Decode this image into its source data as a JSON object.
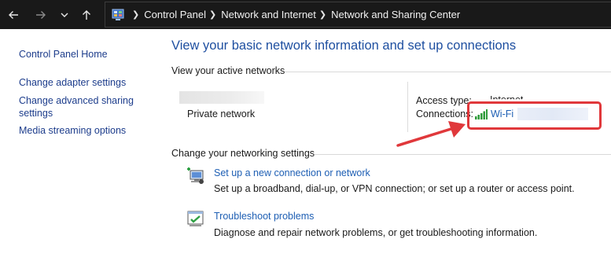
{
  "breadcrumb": {
    "items": [
      "Control Panel",
      "Network and Internet",
      "Network and Sharing Center"
    ]
  },
  "sidebar": {
    "items": [
      {
        "label": "Control Panel Home"
      },
      {
        "label": "Change adapter settings"
      },
      {
        "label": "Change advanced sharing\nsettings"
      },
      {
        "label": "Media streaming options"
      }
    ]
  },
  "main": {
    "title": "View your basic network information and set up connections",
    "active_networks_label": "View your active networks",
    "network_type": "Private network",
    "access_type_label": "Access type:",
    "access_type_value": "Internet",
    "connections_label": "Connections:",
    "connection_name": "Wi-Fi",
    "change_settings_label": "Change your networking settings",
    "tasks": [
      {
        "title": "Set up a new connection or network",
        "description": "Set up a broadband, dial-up, or VPN connection; or set up a router or access point.",
        "icon": "new-connection-icon"
      },
      {
        "title": "Troubleshoot problems",
        "description": "Diagnose and repair network problems, or get troubleshooting information.",
        "icon": "troubleshoot-icon"
      }
    ]
  },
  "colors": {
    "address_bar_bg": "#191919",
    "link": "#1e5fb4",
    "title": "#1e4fa0",
    "annotation": "#e0383b"
  }
}
